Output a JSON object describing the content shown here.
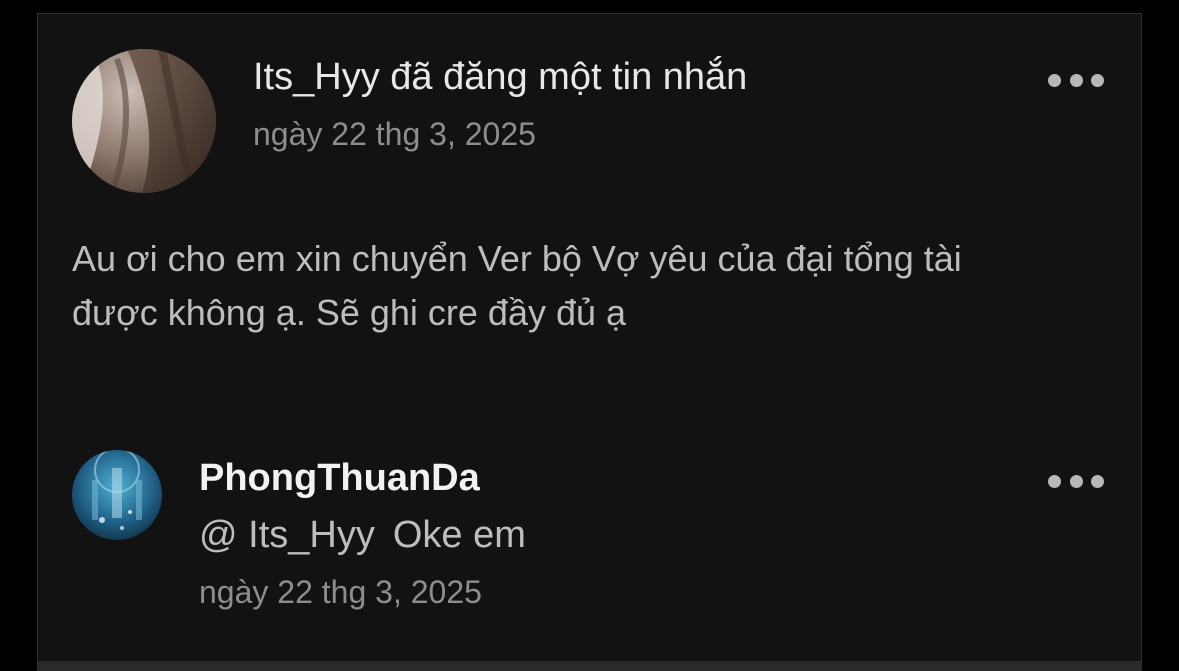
{
  "post": {
    "header": "Its_Hyy đã đăng một tin nhắn",
    "date": "ngày 22 thg 3, 2025",
    "body_line1": "Au ơi cho em xin chuyển Ver bộ Vợ yêu của đại tổng tài",
    "body_line2": "được không ạ. Sẽ ghi cre đầy đủ ạ",
    "menu_icon": "more-horizontal-icon"
  },
  "reply": {
    "author": "PhongThuanDa",
    "mention": "@ Its_Hyy",
    "text": "Oke em",
    "date": "ngày 22 thg 3, 2025",
    "menu_icon": "more-horizontal-icon"
  },
  "colors": {
    "background": "#000000",
    "card": "#121212",
    "primary_text": "#e8e8e8",
    "secondary_text": "#8d8d8d",
    "body_text": "#bdbdbd"
  }
}
